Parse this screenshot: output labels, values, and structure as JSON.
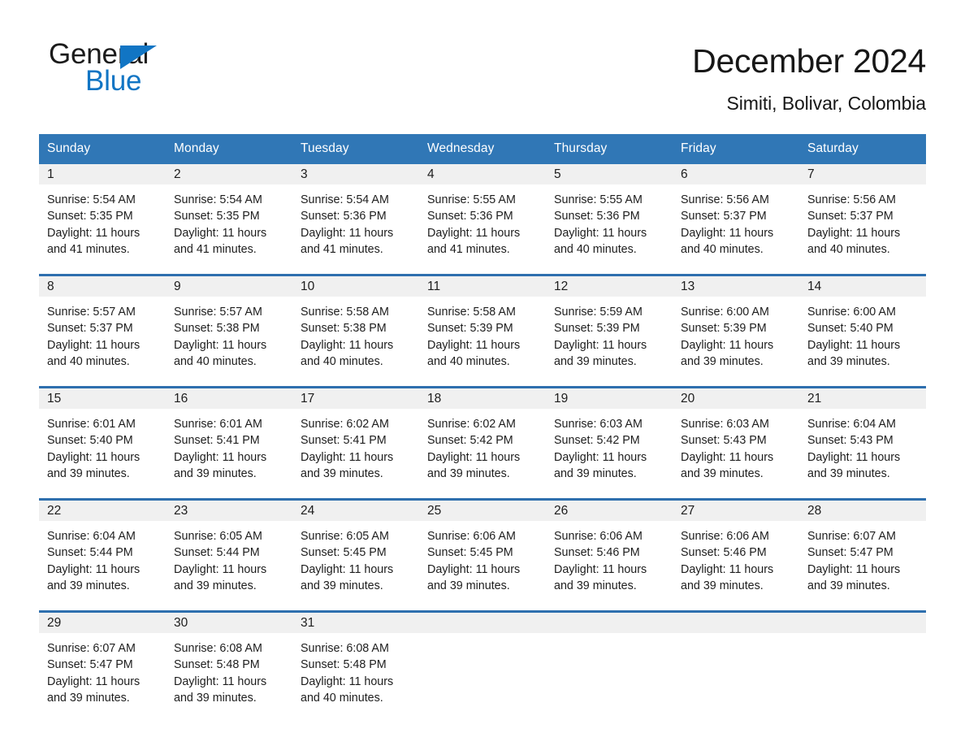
{
  "brand": {
    "name_part1": "General",
    "name_part2": "Blue",
    "triangle_icon": "triangle-icon",
    "accent_color": "#1175c4"
  },
  "header": {
    "title": "December 2024",
    "subtitle": "Simiti, Bolivar, Colombia"
  },
  "colors": {
    "header_blue": "#3077B6",
    "row_divider_blue": "#2E6FAE",
    "daynum_band": "#f0f0f0",
    "text": "#1d1d1d"
  },
  "calendar": {
    "weekday_headers": [
      "Sunday",
      "Monday",
      "Tuesday",
      "Wednesday",
      "Thursday",
      "Friday",
      "Saturday"
    ],
    "weeks": [
      [
        {
          "day": "1",
          "sunrise": "Sunrise: 5:54 AM",
          "sunset": "Sunset: 5:35 PM",
          "daylight": "Daylight: 11 hours and 41 minutes."
        },
        {
          "day": "2",
          "sunrise": "Sunrise: 5:54 AM",
          "sunset": "Sunset: 5:35 PM",
          "daylight": "Daylight: 11 hours and 41 minutes."
        },
        {
          "day": "3",
          "sunrise": "Sunrise: 5:54 AM",
          "sunset": "Sunset: 5:36 PM",
          "daylight": "Daylight: 11 hours and 41 minutes."
        },
        {
          "day": "4",
          "sunrise": "Sunrise: 5:55 AM",
          "sunset": "Sunset: 5:36 PM",
          "daylight": "Daylight: 11 hours and 41 minutes."
        },
        {
          "day": "5",
          "sunrise": "Sunrise: 5:55 AM",
          "sunset": "Sunset: 5:36 PM",
          "daylight": "Daylight: 11 hours and 40 minutes."
        },
        {
          "day": "6",
          "sunrise": "Sunrise: 5:56 AM",
          "sunset": "Sunset: 5:37 PM",
          "daylight": "Daylight: 11 hours and 40 minutes."
        },
        {
          "day": "7",
          "sunrise": "Sunrise: 5:56 AM",
          "sunset": "Sunset: 5:37 PM",
          "daylight": "Daylight: 11 hours and 40 minutes."
        }
      ],
      [
        {
          "day": "8",
          "sunrise": "Sunrise: 5:57 AM",
          "sunset": "Sunset: 5:37 PM",
          "daylight": "Daylight: 11 hours and 40 minutes."
        },
        {
          "day": "9",
          "sunrise": "Sunrise: 5:57 AM",
          "sunset": "Sunset: 5:38 PM",
          "daylight": "Daylight: 11 hours and 40 minutes."
        },
        {
          "day": "10",
          "sunrise": "Sunrise: 5:58 AM",
          "sunset": "Sunset: 5:38 PM",
          "daylight": "Daylight: 11 hours and 40 minutes."
        },
        {
          "day": "11",
          "sunrise": "Sunrise: 5:58 AM",
          "sunset": "Sunset: 5:39 PM",
          "daylight": "Daylight: 11 hours and 40 minutes."
        },
        {
          "day": "12",
          "sunrise": "Sunrise: 5:59 AM",
          "sunset": "Sunset: 5:39 PM",
          "daylight": "Daylight: 11 hours and 39 minutes."
        },
        {
          "day": "13",
          "sunrise": "Sunrise: 6:00 AM",
          "sunset": "Sunset: 5:39 PM",
          "daylight": "Daylight: 11 hours and 39 minutes."
        },
        {
          "day": "14",
          "sunrise": "Sunrise: 6:00 AM",
          "sunset": "Sunset: 5:40 PM",
          "daylight": "Daylight: 11 hours and 39 minutes."
        }
      ],
      [
        {
          "day": "15",
          "sunrise": "Sunrise: 6:01 AM",
          "sunset": "Sunset: 5:40 PM",
          "daylight": "Daylight: 11 hours and 39 minutes."
        },
        {
          "day": "16",
          "sunrise": "Sunrise: 6:01 AM",
          "sunset": "Sunset: 5:41 PM",
          "daylight": "Daylight: 11 hours and 39 minutes."
        },
        {
          "day": "17",
          "sunrise": "Sunrise: 6:02 AM",
          "sunset": "Sunset: 5:41 PM",
          "daylight": "Daylight: 11 hours and 39 minutes."
        },
        {
          "day": "18",
          "sunrise": "Sunrise: 6:02 AM",
          "sunset": "Sunset: 5:42 PM",
          "daylight": "Daylight: 11 hours and 39 minutes."
        },
        {
          "day": "19",
          "sunrise": "Sunrise: 6:03 AM",
          "sunset": "Sunset: 5:42 PM",
          "daylight": "Daylight: 11 hours and 39 minutes."
        },
        {
          "day": "20",
          "sunrise": "Sunrise: 6:03 AM",
          "sunset": "Sunset: 5:43 PM",
          "daylight": "Daylight: 11 hours and 39 minutes."
        },
        {
          "day": "21",
          "sunrise": "Sunrise: 6:04 AM",
          "sunset": "Sunset: 5:43 PM",
          "daylight": "Daylight: 11 hours and 39 minutes."
        }
      ],
      [
        {
          "day": "22",
          "sunrise": "Sunrise: 6:04 AM",
          "sunset": "Sunset: 5:44 PM",
          "daylight": "Daylight: 11 hours and 39 minutes."
        },
        {
          "day": "23",
          "sunrise": "Sunrise: 6:05 AM",
          "sunset": "Sunset: 5:44 PM",
          "daylight": "Daylight: 11 hours and 39 minutes."
        },
        {
          "day": "24",
          "sunrise": "Sunrise: 6:05 AM",
          "sunset": "Sunset: 5:45 PM",
          "daylight": "Daylight: 11 hours and 39 minutes."
        },
        {
          "day": "25",
          "sunrise": "Sunrise: 6:06 AM",
          "sunset": "Sunset: 5:45 PM",
          "daylight": "Daylight: 11 hours and 39 minutes."
        },
        {
          "day": "26",
          "sunrise": "Sunrise: 6:06 AM",
          "sunset": "Sunset: 5:46 PM",
          "daylight": "Daylight: 11 hours and 39 minutes."
        },
        {
          "day": "27",
          "sunrise": "Sunrise: 6:06 AM",
          "sunset": "Sunset: 5:46 PM",
          "daylight": "Daylight: 11 hours and 39 minutes."
        },
        {
          "day": "28",
          "sunrise": "Sunrise: 6:07 AM",
          "sunset": "Sunset: 5:47 PM",
          "daylight": "Daylight: 11 hours and 39 minutes."
        }
      ],
      [
        {
          "day": "29",
          "sunrise": "Sunrise: 6:07 AM",
          "sunset": "Sunset: 5:47 PM",
          "daylight": "Daylight: 11 hours and 39 minutes."
        },
        {
          "day": "30",
          "sunrise": "Sunrise: 6:08 AM",
          "sunset": "Sunset: 5:48 PM",
          "daylight": "Daylight: 11 hours and 39 minutes."
        },
        {
          "day": "31",
          "sunrise": "Sunrise: 6:08 AM",
          "sunset": "Sunset: 5:48 PM",
          "daylight": "Daylight: 11 hours and 40 minutes."
        },
        {
          "day": "",
          "sunrise": "",
          "sunset": "",
          "daylight": ""
        },
        {
          "day": "",
          "sunrise": "",
          "sunset": "",
          "daylight": ""
        },
        {
          "day": "",
          "sunrise": "",
          "sunset": "",
          "daylight": ""
        },
        {
          "day": "",
          "sunrise": "",
          "sunset": "",
          "daylight": ""
        }
      ]
    ]
  }
}
